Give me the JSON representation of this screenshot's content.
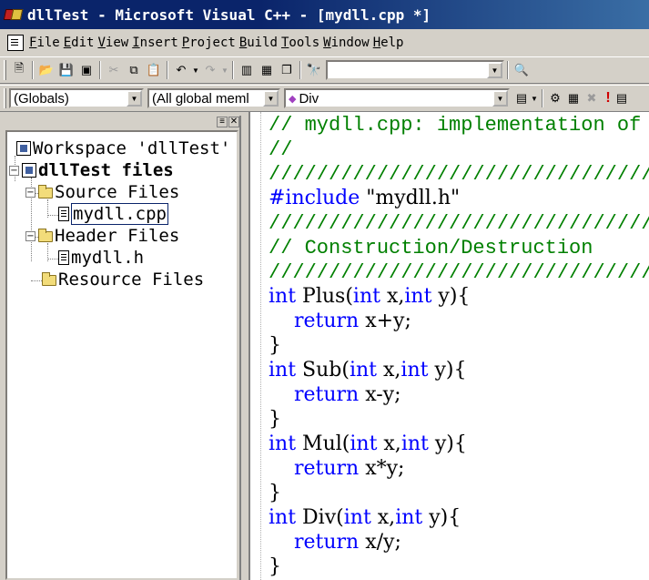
{
  "window": {
    "title": "dllTest - Microsoft Visual C++ - [mydll.cpp *]"
  },
  "menu": [
    {
      "u": "F",
      "rest": "ile"
    },
    {
      "u": "E",
      "rest": "dit"
    },
    {
      "u": "V",
      "rest": "iew"
    },
    {
      "u": "I",
      "rest": "nsert"
    },
    {
      "u": "P",
      "rest": "roject"
    },
    {
      "u": "B",
      "rest": "uild"
    },
    {
      "u": "T",
      "rest": "ools"
    },
    {
      "u": "W",
      "rest": "indow"
    },
    {
      "u": "H",
      "rest": "elp"
    }
  ],
  "toolbar": {
    "find_value": ""
  },
  "wizardbar": {
    "class_value": "(Globals)",
    "filter_value": "(All global meml",
    "member_value": "Div"
  },
  "workspace": {
    "root": "Workspace 'dllTest'",
    "project": "dllTest files",
    "source_folder": "Source Files",
    "source_file": "mydll.cpp",
    "header_folder": "Header Files",
    "header_file": "mydll.h",
    "resource_folder": "Resource Files"
  },
  "editor": {
    "lines": [
      {
        "parts": [
          {
            "t": "// mydll.cpp: implementation of",
            "c": "comment"
          }
        ]
      },
      {
        "parts": [
          {
            "t": "//",
            "c": "comment"
          }
        ]
      },
      {
        "parts": [
          {
            "t": "////////////////////////////////",
            "c": "comment"
          }
        ]
      },
      {
        "parts": [
          {
            "t": "#include",
            "c": "kw"
          },
          {
            "t": " \"mydll.h\"",
            "c": "text"
          }
        ]
      },
      {
        "parts": [
          {
            "t": "////////////////////////////////",
            "c": "comment"
          }
        ]
      },
      {
        "parts": [
          {
            "t": "// Construction/Destruction",
            "c": "comment"
          }
        ]
      },
      {
        "parts": [
          {
            "t": "////////////////////////////////",
            "c": "comment"
          }
        ]
      },
      {
        "parts": [
          {
            "t": "int",
            "c": "kw"
          },
          {
            "t": " Plus(",
            "c": "text"
          },
          {
            "t": "int",
            "c": "kw"
          },
          {
            "t": " x,",
            "c": "text"
          },
          {
            "t": "int",
            "c": "kw"
          },
          {
            "t": " y){",
            "c": "text"
          }
        ]
      },
      {
        "parts": [
          {
            "t": "    ",
            "c": "text"
          },
          {
            "t": "return",
            "c": "kw"
          },
          {
            "t": " x+y;",
            "c": "text"
          }
        ]
      },
      {
        "parts": [
          {
            "t": "}",
            "c": "text"
          }
        ]
      },
      {
        "parts": [
          {
            "t": "int",
            "c": "kw"
          },
          {
            "t": " Sub(",
            "c": "text"
          },
          {
            "t": "int",
            "c": "kw"
          },
          {
            "t": " x,",
            "c": "text"
          },
          {
            "t": "int",
            "c": "kw"
          },
          {
            "t": " y){",
            "c": "text"
          }
        ]
      },
      {
        "parts": [
          {
            "t": "    ",
            "c": "text"
          },
          {
            "t": "return",
            "c": "kw"
          },
          {
            "t": " x-y;",
            "c": "text"
          }
        ]
      },
      {
        "parts": [
          {
            "t": "}",
            "c": "text"
          }
        ]
      },
      {
        "parts": [
          {
            "t": "int",
            "c": "kw"
          },
          {
            "t": " Mul(",
            "c": "text"
          },
          {
            "t": "int",
            "c": "kw"
          },
          {
            "t": " x,",
            "c": "text"
          },
          {
            "t": "int",
            "c": "kw"
          },
          {
            "t": " y){",
            "c": "text"
          }
        ]
      },
      {
        "parts": [
          {
            "t": "    ",
            "c": "text"
          },
          {
            "t": "return",
            "c": "kw"
          },
          {
            "t": " x*y;",
            "c": "text"
          }
        ]
      },
      {
        "parts": [
          {
            "t": "}",
            "c": "text"
          }
        ]
      },
      {
        "parts": [
          {
            "t": "int",
            "c": "kw"
          },
          {
            "t": " Div(",
            "c": "text"
          },
          {
            "t": "int",
            "c": "kw"
          },
          {
            "t": " x,",
            "c": "text"
          },
          {
            "t": "int",
            "c": "kw"
          },
          {
            "t": " y){",
            "c": "text"
          }
        ]
      },
      {
        "parts": [
          {
            "t": "    ",
            "c": "text"
          },
          {
            "t": "return",
            "c": "kw"
          },
          {
            "t": " x/y;",
            "c": "text"
          }
        ]
      },
      {
        "parts": [
          {
            "t": "}",
            "c": "text"
          }
        ]
      }
    ]
  },
  "colors": {
    "titlebar": "#0a246a",
    "comment": "#008000",
    "keyword": "#0000ff"
  }
}
